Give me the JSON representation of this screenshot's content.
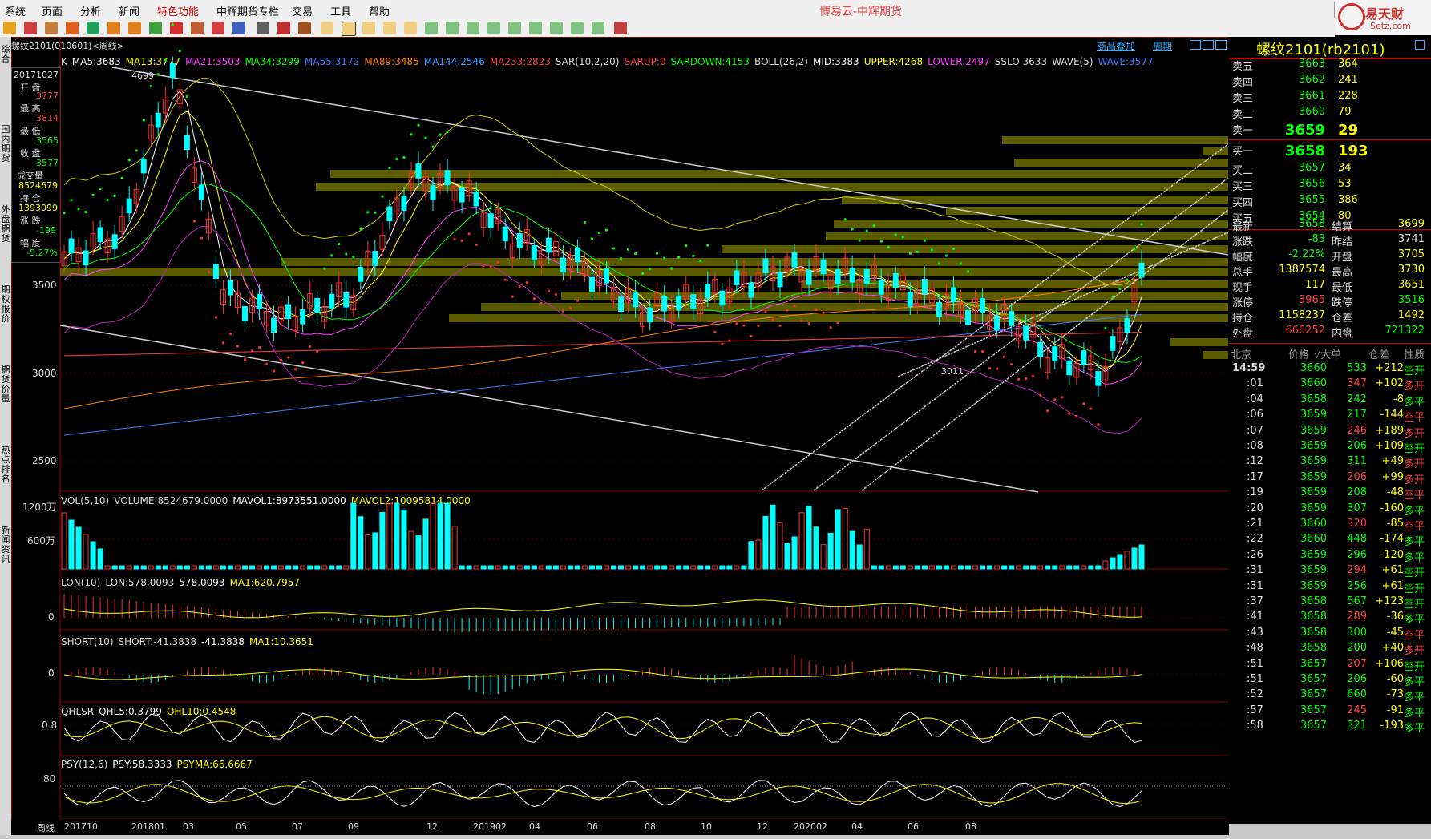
{
  "menu": {
    "items": [
      "系统",
      "页面",
      "分析",
      "新闻",
      "特色功能",
      "中辉期货专栏",
      "交易",
      "工具",
      "帮助"
    ],
    "title": "博易云-中辉期货"
  },
  "brand": {
    "name": "易天财",
    "url": "Setz.com"
  },
  "header": {
    "symbol": "螺纹2101(010601)<周线>",
    "link1": "商品叠加",
    "link2": "周期"
  },
  "sidebar": [
    "综合",
    "国内期货",
    "外盘期货",
    "期权报价",
    "期货价量",
    "热点排名",
    "新闻资讯"
  ],
  "legend_main": [
    {
      "t": "K",
      "c": "#dddddd"
    },
    {
      "t": "MA5:3683",
      "c": "#ffffff"
    },
    {
      "t": "MA13:3777",
      "c": "#ffff00"
    },
    {
      "t": "MA21:3503",
      "c": "#ff40ff"
    },
    {
      "t": "MA34:3299",
      "c": "#00ff00"
    },
    {
      "t": "MA55:3172",
      "c": "#4080ff"
    },
    {
      "t": "MA89:3485",
      "c": "#ff8000"
    },
    {
      "t": "MA144:2546",
      "c": "#40a0ff"
    },
    {
      "t": "MA233:2823",
      "c": "#ff4040"
    },
    {
      "t": "SAR(10,2,20)",
      "c": "#dddddd"
    },
    {
      "t": "SARUP:0",
      "c": "#ff4040"
    },
    {
      "t": "SARDOWN:4153",
      "c": "#00ff00"
    },
    {
      "t": "BOLL(26,2)",
      "c": "#dddddd"
    },
    {
      "t": "MID:3383",
      "c": "#ffffff"
    },
    {
      "t": "UPPER:4268",
      "c": "#ffff00"
    },
    {
      "t": "LOWER:2497",
      "c": "#ff40ff"
    },
    {
      "t": "SSLO 3633",
      "c": "#dddddd"
    },
    {
      "t": "WAVE(5)",
      "c": "#dddddd"
    },
    {
      "t": "WAVE:3577",
      "c": "#4080ff"
    }
  ],
  "legend_vol": [
    {
      "t": "VOL(5,10)",
      "c": "#dddddd"
    },
    {
      "t": "VOLUME:8524679.0000",
      "c": "#dddddd"
    },
    {
      "t": "MAVOL1:8973551.0000",
      "c": "#ffffff"
    },
    {
      "t": "MAVOL2:10095814.0000",
      "c": "#ffff00"
    }
  ],
  "legend_lon": [
    {
      "t": "LON(10)",
      "c": "#dddddd"
    },
    {
      "t": "LON:578.0093",
      "c": "#dddddd"
    },
    {
      "t": "578.0093",
      "c": "#ffffff"
    },
    {
      "t": "MA1:620.7957",
      "c": "#ffff00"
    }
  ],
  "legend_short": [
    {
      "t": "SHORT(10)",
      "c": "#dddddd"
    },
    {
      "t": "SHORT:-41.3838",
      "c": "#dddddd"
    },
    {
      "t": "-41.3838",
      "c": "#ffffff"
    },
    {
      "t": "MA1:10.3651",
      "c": "#ffff00"
    }
  ],
  "legend_qhl": [
    {
      "t": "QHLSR",
      "c": "#dddddd"
    },
    {
      "t": "QHL5:0.3799",
      "c": "#ffffff"
    },
    {
      "t": "QHL10:0.4548",
      "c": "#ffff00"
    }
  ],
  "legend_psy": [
    {
      "t": "PSY(12,6)",
      "c": "#dddddd"
    },
    {
      "t": "PSY:58.3333",
      "c": "#ffffff"
    },
    {
      "t": "PSYMA:66.6667",
      "c": "#ffff00"
    }
  ],
  "info": {
    "date": "20171027",
    "open_l": "开 盘",
    "open": "3777",
    "high_l": "最 高",
    "high": "3814",
    "low_l": "最 低",
    "low": "3565",
    "close_l": "收 盘",
    "close": "3577",
    "vol_l": "成交量",
    "vol": "8524679",
    "oi_l": "持 仓",
    "oi": "1393099",
    "chg_l": "涨 跌",
    "chg": "-199",
    "pct_l": "幅 度",
    "pct": "-5.27%"
  },
  "axis": {
    "main": [
      "3500",
      "3000",
      "2500"
    ],
    "vol": [
      "1200万",
      "600万"
    ],
    "lon": "0",
    "short": "0",
    "qhl": "0.8",
    "psy": "80",
    "peak": "4699",
    "trough": "3011",
    "period": "周线"
  },
  "dates": [
    "201710",
    "201801",
    "03",
    "05",
    "07",
    "09",
    "12",
    "201902",
    "04",
    "06",
    "08",
    "10",
    "12",
    "202002",
    "04",
    "06",
    "08"
  ],
  "quote": {
    "title": "螺纹2101(rb2101)",
    "asks": [
      {
        "l": "卖五",
        "p": "3663",
        "v": "364"
      },
      {
        "l": "卖四",
        "p": "3662",
        "v": "241"
      },
      {
        "l": "卖三",
        "p": "3661",
        "v": "228"
      },
      {
        "l": "卖二",
        "p": "3660",
        "v": "79"
      },
      {
        "l": "卖一",
        "p": "3659",
        "v": "29"
      }
    ],
    "bids": [
      {
        "l": "买一",
        "p": "3658",
        "v": "193"
      },
      {
        "l": "买二",
        "p": "3657",
        "v": "34"
      },
      {
        "l": "买三",
        "p": "3656",
        "v": "53"
      },
      {
        "l": "买四",
        "p": "3655",
        "v": "386"
      },
      {
        "l": "买五",
        "p": "3654",
        "v": "80"
      }
    ],
    "stats": [
      {
        "a": "最新",
        "av": "3658",
        "ac": "#00ff00",
        "b": "结算",
        "bv": "3699",
        "bc": "#ffff00"
      },
      {
        "a": "涨跌",
        "av": "-83",
        "ac": "#00ff00",
        "b": "昨结",
        "bv": "3741",
        "bc": "#dddddd"
      },
      {
        "a": "幅度",
        "av": "-2.22%",
        "ac": "#00ff00",
        "b": "开盘",
        "bv": "3705",
        "bc": "#ffff00"
      },
      {
        "a": "总手",
        "av": "1387574",
        "ac": "#ffff00",
        "b": "最高",
        "bv": "3730",
        "bc": "#ffff00"
      },
      {
        "a": "现手",
        "av": "117",
        "ac": "#ffff00",
        "b": "最低",
        "bv": "3651",
        "bc": "#ffff00"
      },
      {
        "a": "涨停",
        "av": "3965",
        "ac": "#ff4040",
        "b": "跌停",
        "bv": "3516",
        "bc": "#00ff00"
      },
      {
        "a": "持仓",
        "av": "1158237",
        "ac": "#ffff00",
        "b": "仓差",
        "bv": "1492",
        "bc": "#ffff00"
      },
      {
        "a": "外盘",
        "av": "666252",
        "ac": "#ff4040",
        "b": "内盘",
        "bv": "721322",
        "bc": "#00ff00"
      }
    ],
    "tick_header": [
      "北京",
      "价格",
      "√大单",
      "仓差",
      "性质"
    ],
    "ticks": [
      [
        "14:59",
        "3660",
        "533",
        "+212",
        "空开"
      ],
      [
        ":01",
        "3660",
        "347",
        "+102",
        "多开"
      ],
      [
        ":04",
        "3658",
        "242",
        "-8",
        "多平"
      ],
      [
        ":06",
        "3659",
        "217",
        "-144",
        "空平"
      ],
      [
        ":07",
        "3659",
        "246",
        "+189",
        "多开"
      ],
      [
        ":08",
        "3659",
        "206",
        "+109",
        "空开"
      ],
      [
        ":12",
        "3659",
        "311",
        "+49",
        "多开"
      ],
      [
        ":17",
        "3659",
        "206",
        "+99",
        "多开"
      ],
      [
        ":19",
        "3659",
        "208",
        "-48",
        "空平"
      ],
      [
        ":20",
        "3659",
        "307",
        "-160",
        "多平"
      ],
      [
        ":21",
        "3660",
        "320",
        "-85",
        "空平"
      ],
      [
        ":22",
        "3660",
        "448",
        "-174",
        "多平"
      ],
      [
        ":26",
        "3659",
        "296",
        "-120",
        "多平"
      ],
      [
        ":31",
        "3659",
        "294",
        "+61",
        "空开"
      ],
      [
        ":31",
        "3659",
        "256",
        "+61",
        "空开"
      ],
      [
        ":37",
        "3658",
        "567",
        "+123",
        "空开"
      ],
      [
        ":41",
        "3658",
        "289",
        "-36",
        "多平"
      ],
      [
        ":43",
        "3658",
        "300",
        "-45",
        "空平"
      ],
      [
        ":48",
        "3658",
        "200",
        "+40",
        "多开"
      ],
      [
        ":51",
        "3657",
        "207",
        "+106",
        "空开"
      ],
      [
        ":51",
        "3657",
        "206",
        "-60",
        "多平"
      ],
      [
        ":52",
        "3657",
        "660",
        "-73",
        "多平"
      ],
      [
        ":57",
        "3657",
        "245",
        "-91",
        "多平"
      ],
      [
        ":58",
        "3657",
        "321",
        "-193",
        "多平"
      ]
    ]
  }
}
